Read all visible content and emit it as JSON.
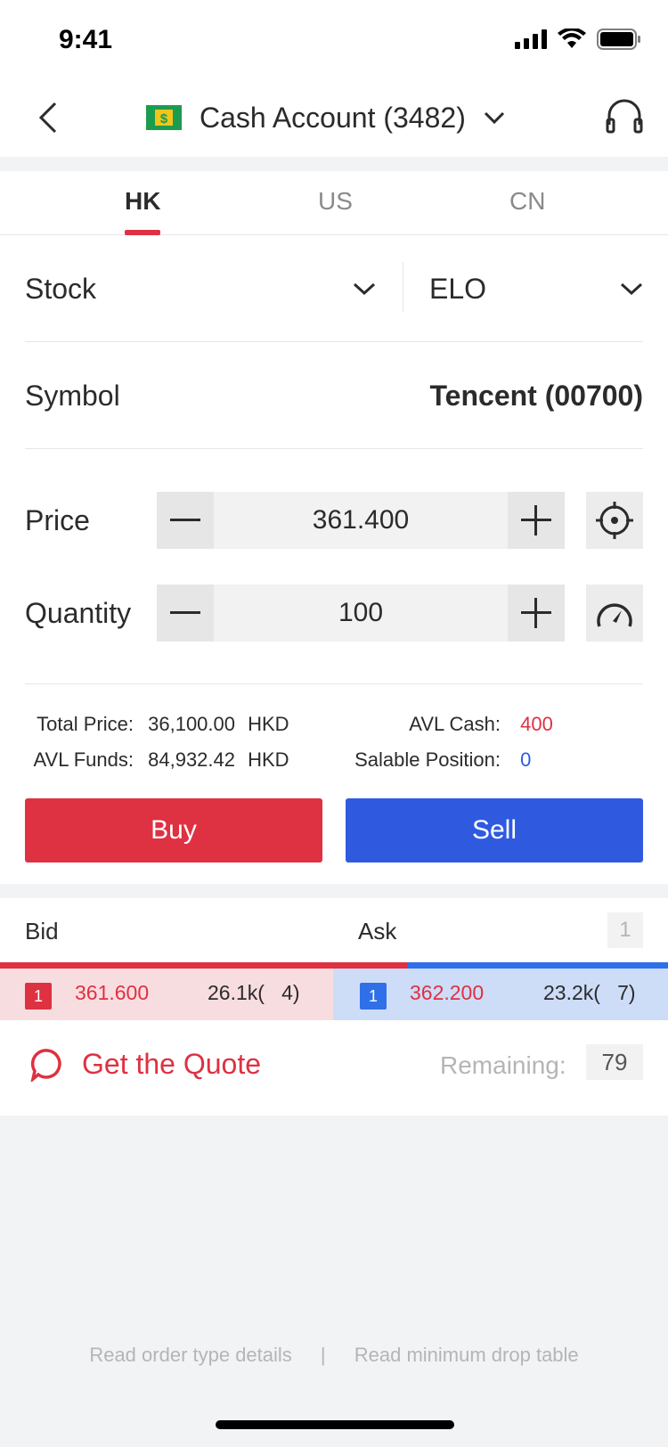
{
  "status_bar": {
    "time": "9:41"
  },
  "header": {
    "account_title": "Cash Account (3482)",
    "icons": [
      "back-icon",
      "cash-account-icon",
      "chevron-down-icon",
      "headset-icon"
    ]
  },
  "tabs": [
    {
      "label": "HK",
      "active": true
    },
    {
      "label": "US",
      "active": false
    },
    {
      "label": "CN",
      "active": false
    }
  ],
  "order": {
    "product_type": "Stock",
    "order_type": "ELO",
    "symbol_label": "Symbol",
    "symbol_value": "Tencent (00700)",
    "price_label": "Price",
    "price_value": "361.400",
    "quantity_label": "Quantity",
    "quantity_value": "100"
  },
  "summary": {
    "total_price_label": "Total Price:",
    "total_price_value": "36,100.00",
    "total_price_ccy": "HKD",
    "avl_funds_label": "AVL Funds:",
    "avl_funds_value": "84,932.42",
    "avl_funds_ccy": "HKD",
    "avl_cash_label": "AVL Cash:",
    "avl_cash_value": "400",
    "salable_label": "Salable Position:",
    "salable_value": "0"
  },
  "actions": {
    "buy_label": "Buy",
    "sell_label": "Sell"
  },
  "order_book": {
    "bid_label": "Bid",
    "ask_label": "Ask",
    "depth_level": "1",
    "bid_ratio": 0.61,
    "bid": {
      "level": "1",
      "price": "361.600",
      "volume": "26.1k(   4)"
    },
    "ask": {
      "level": "1",
      "price": "362.200",
      "volume": "23.2k(   7)"
    }
  },
  "quote": {
    "label": "Get the Quote",
    "remaining_label": "Remaining:",
    "remaining_value": "79"
  },
  "footer": {
    "link_order_types": "Read order type details",
    "separator": "|",
    "link_drop_table": "Read minimum drop table"
  },
  "colors": {
    "buy_red": "#de3142",
    "sell_blue": "#2f5ae0",
    "bid_bg": "#f8dde0",
    "ask_bg": "#cddcf7"
  }
}
